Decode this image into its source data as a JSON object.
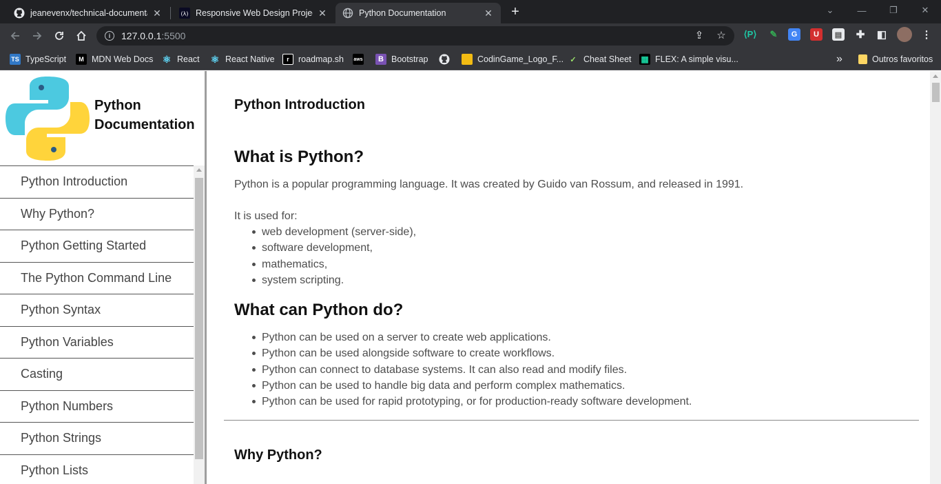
{
  "browser": {
    "tabs": [
      {
        "title": "jeanevenx/technical-documentat",
        "icon": "github-icon"
      },
      {
        "title": "Responsive Web Design Projects",
        "icon": "freecodecamp-icon"
      },
      {
        "title": "Python Documentation",
        "icon": "globe-icon",
        "active": true
      }
    ],
    "address": {
      "host": "127.0.0.1",
      "port": ":5500"
    },
    "bookmarks": [
      {
        "label": "TypeScript",
        "icon": "typescript-icon",
        "badge": "TS",
        "color": "#3178c6"
      },
      {
        "label": "MDN Web Docs",
        "icon": "mdn-icon",
        "badge": "M",
        "color": "#000000"
      },
      {
        "label": "React",
        "icon": "react-icon",
        "badge": "⚛",
        "color": "#35363a"
      },
      {
        "label": "React Native",
        "icon": "react-icon",
        "badge": "⚛",
        "color": "#35363a"
      },
      {
        "label": "roadmap.sh",
        "icon": "roadmap-icon",
        "badge": "r",
        "color": "#000000"
      },
      {
        "label": "",
        "icon": "aws-icon",
        "badge": "aws",
        "color": "#000000"
      },
      {
        "label": "Bootstrap",
        "icon": "bootstrap-icon",
        "badge": "B",
        "color": "#7952b3"
      },
      {
        "label": "",
        "icon": "github-icon",
        "badge": "●",
        "color": "#35363a"
      },
      {
        "label": "CodinGame_Logo_F...",
        "icon": "codingame-icon",
        "badge": "",
        "color": "#f2bb13"
      },
      {
        "label": "Cheat Sheet",
        "icon": "cheat-sheet-icon",
        "badge": "✓",
        "color": "#35363a"
      },
      {
        "label": "FLEX: A simple visu...",
        "icon": "flex-icon",
        "badge": "▦",
        "color": "#000000"
      }
    ],
    "other_bookmarks": "Outros favoritos",
    "more_bookmarks": "»"
  },
  "sidebar": {
    "brand_line1": "Python",
    "brand_line2": "Documentation",
    "items": [
      {
        "label": "Python Introduction"
      },
      {
        "label": "Why Python?"
      },
      {
        "label": "Python Getting Started"
      },
      {
        "label": "The Python Command Line"
      },
      {
        "label": "Python Syntax"
      },
      {
        "label": "Python Variables"
      },
      {
        "label": "Casting"
      },
      {
        "label": "Python Numbers"
      },
      {
        "label": "Python Strings"
      },
      {
        "label": "Python Lists"
      }
    ]
  },
  "main": {
    "section1_title": "Python Introduction",
    "h_what": "What is Python?",
    "p_intro": "Python is a popular programming language. It was created by Guido van Rossum, and released in 1991.",
    "p_used_for": "It is used for:",
    "used_for": [
      "web development (server-side),",
      "software development,",
      "mathematics,",
      "system scripting."
    ],
    "h_can_do": "What can Python do?",
    "can_do": [
      "Python can be used on a server to create web applications.",
      "Python can be used alongside software to create workflows.",
      "Python can connect to database systems. It can also read and modify files.",
      "Python can be used to handle big data and perform complex mathematics.",
      "Python can be used for rapid prototyping, or for production-ready software development."
    ],
    "section2_title": "Why Python?"
  },
  "colors": {
    "python_blue": "#4cc9e0",
    "python_yellow": "#ffd43b",
    "browser_dark": "#202124",
    "browser_toolbar": "#35363a"
  }
}
